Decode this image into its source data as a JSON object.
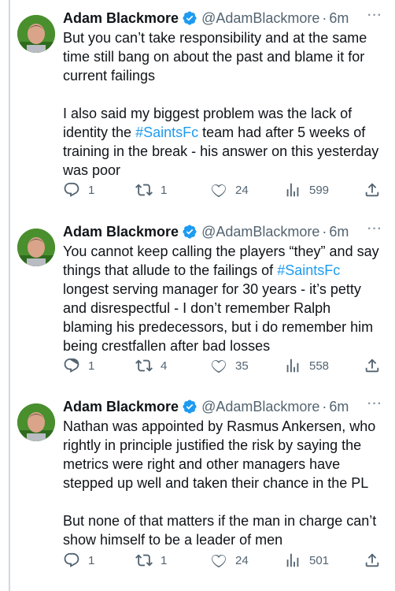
{
  "tweets": [
    {
      "name": "Adam Blackmore",
      "handle": "@AdamBlackmore",
      "separator": "·",
      "time": "6m",
      "more": "···",
      "paragraphs": [
        [
          "But you can’t take responsibility and at the same time still bang on about the past and blame it for current failings"
        ],
        [
          "I also said my biggest problem was the lack of identity the ",
          "#SaintsFc",
          " team had after 5 weeks of training in the break - his answer on this yesterday was poor"
        ]
      ],
      "replies": "1",
      "retweets": "1",
      "likes": "24",
      "views": "599"
    },
    {
      "name": "Adam Blackmore",
      "handle": "@AdamBlackmore",
      "separator": "·",
      "time": "6m",
      "more": "···",
      "paragraphs": [
        [
          "You cannot keep calling the players “they” and say things that allude to the failings of ",
          "#SaintsFc",
          " longest serving manager for 30 years - it’s petty and disrespectful - I don’t remember Ralph blaming his predecessors, but i do remember him being crestfallen after bad losses"
        ]
      ],
      "replies": "1",
      "retweets": "4",
      "likes": "35",
      "views": "558"
    },
    {
      "name": "Adam Blackmore",
      "handle": "@AdamBlackmore",
      "separator": "·",
      "time": "6m",
      "more": "···",
      "paragraphs": [
        [
          "Nathan was appointed by Rasmus Ankersen, who rightly in principle justified the risk by saying the metrics were right and other managers have stepped up well and taken their chance in the PL"
        ],
        [
          "But none of that matters if the man in charge can’t show himself to be a leader of men"
        ]
      ],
      "replies": "1",
      "retweets": "1",
      "likes": "24",
      "views": "501"
    }
  ],
  "colors": {
    "text": "#0f1419",
    "secondary": "#536471",
    "accent": "#1d9bf0",
    "thread_line": "#cfd9de"
  },
  "icons": {
    "verified": "verified-badge-icon",
    "reply": "reply-icon",
    "retweet": "retweet-icon",
    "like": "heart-icon",
    "views": "views-icon",
    "share": "share-icon",
    "more": "more-icon"
  }
}
